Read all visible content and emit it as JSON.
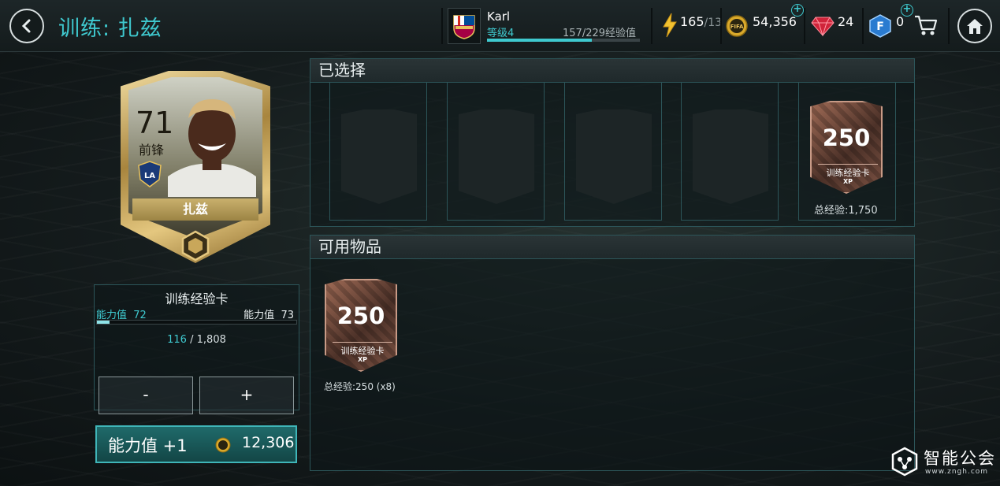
{
  "header": {
    "title": "训练: 扎兹",
    "back_icon": "chevron-left-icon",
    "home_icon": "home-icon"
  },
  "profile": {
    "username": "Karl",
    "level": "等级4",
    "xp_text": "157/229经验值",
    "xp_progress": 0.686
  },
  "currencies": {
    "energy_value": "165",
    "energy_max": "/13",
    "coins": "54,356",
    "gems": "24",
    "fifa_points": "0"
  },
  "selected_panel": {
    "title": "已选择",
    "card": {
      "value": "250",
      "name": "训练经验卡",
      "tag": "XP"
    },
    "total_xp": "总经验:1,750"
  },
  "available_panel": {
    "title": "可用物品",
    "card": {
      "value": "250",
      "name": "训练经验卡",
      "tag": "XP"
    },
    "caption": "总经验:250 (x8)"
  },
  "player_card": {
    "rating": "71",
    "position": "前锋",
    "name": "扎兹",
    "club_badge": "LA"
  },
  "training": {
    "title": "训练经验卡",
    "ovr_current_label": "能力值",
    "ovr_current": "72",
    "ovr_next_label": "能力值",
    "ovr_next": "73",
    "progress_current": "116",
    "progress_sep": "/",
    "progress_max": "1,808",
    "progress_fraction": 0.064,
    "minus_label": "-",
    "plus_label": "+"
  },
  "upgrade": {
    "label": "能力值 +1",
    "cost": "12,306"
  },
  "watermark": {
    "text": "智能公会",
    "url": "www.zngh.com"
  },
  "colors": {
    "accent": "#3fc9cf",
    "gold": "#c9b06d",
    "bronze": "#9e6a55"
  }
}
